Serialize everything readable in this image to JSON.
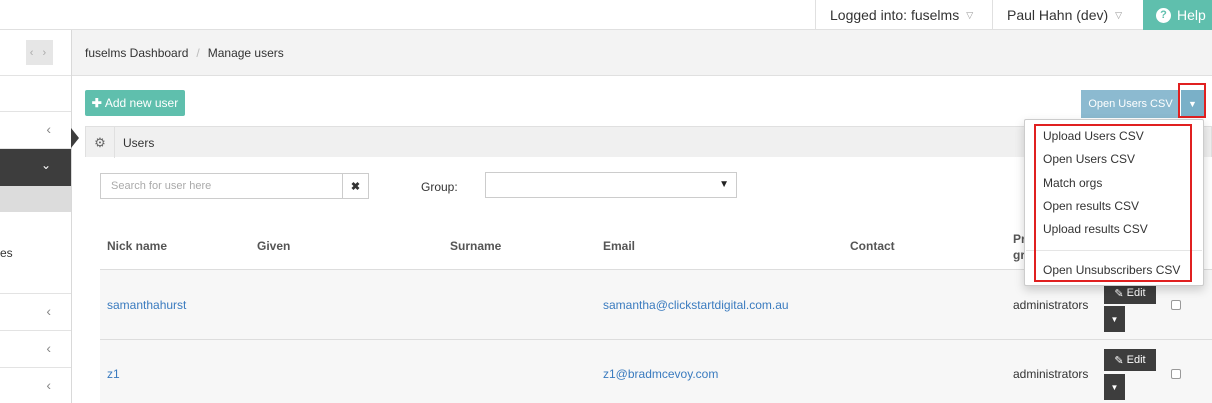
{
  "topbar": {
    "logged_into": "Logged into: fuselms",
    "user": "Paul Hahn (dev)",
    "help": "Help"
  },
  "sidebar": {
    "toggle": "‹ ›",
    "partial_text": "es"
  },
  "breadcrumb": {
    "home": "fuselms Dashboard",
    "separator": "/",
    "current": "Manage users"
  },
  "toolbar": {
    "add_label": "Add new user",
    "open_csv_label": "Open Users CSV"
  },
  "panel": {
    "title": "Users"
  },
  "filters": {
    "search_placeholder": "Search for user here",
    "clear_label": "✖",
    "group_label": "Group:",
    "group_value": ""
  },
  "table": {
    "columns": [
      "Nick name",
      "Given",
      "Surname",
      "Email",
      "Contact"
    ],
    "col_primary_group_line1": "Pr",
    "col_primary_group_line2": "gr",
    "rows": [
      {
        "nick": "samanthahurst",
        "given": "",
        "surname": "",
        "email": "samantha@clickstartdigital.com.au",
        "contact": "",
        "group": "administrators",
        "edit": "Edit"
      },
      {
        "nick": "z1",
        "given": "",
        "surname": "",
        "email": "z1@bradmcevoy.com",
        "contact": "",
        "group": "administrators",
        "edit": "Edit"
      }
    ]
  },
  "dropdown": {
    "items": [
      "Upload Users CSV",
      "Open Users CSV",
      "Match orgs",
      "Open results CSV",
      "Upload results CSV"
    ],
    "last_item": "Open Unsubscribers CSV"
  },
  "colors": {
    "accent_teal": "#5fbfad",
    "dark": "#3d3d3d",
    "link": "#3a7bbf",
    "highlight": "#e02020"
  }
}
